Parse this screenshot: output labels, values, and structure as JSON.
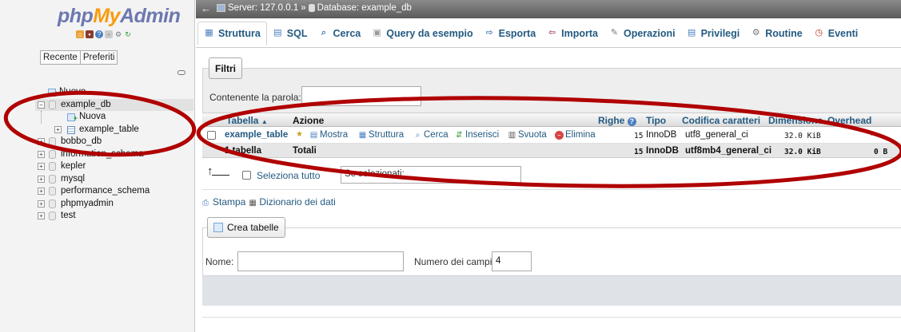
{
  "nav": {
    "logo": {
      "php": "php",
      "my": "My",
      "admin": "Admin"
    },
    "icons": [
      "home-icon",
      "db-icon",
      "help-icon",
      "docs-icon",
      "settings-icon",
      "reload-icon"
    ],
    "tabs": [
      "Recente",
      "Preferiti"
    ],
    "tree": [
      {
        "label": "Nuovo",
        "kind": "new"
      },
      {
        "label": "example_db",
        "kind": "db",
        "selected": true
      },
      {
        "label": "Nuova",
        "kind": "new-table"
      },
      {
        "label": "example_table",
        "kind": "table"
      },
      {
        "label": "bobbo_db",
        "kind": "db"
      },
      {
        "label": "information_schema",
        "kind": "db"
      },
      {
        "label": "kepler",
        "kind": "db"
      },
      {
        "label": "mysql",
        "kind": "db"
      },
      {
        "label": "performance_schema",
        "kind": "db"
      },
      {
        "label": "phpmyadmin",
        "kind": "db"
      },
      {
        "label": "test",
        "kind": "db"
      }
    ]
  },
  "topbar": {
    "server_label": "Server: 127.0.0.1",
    "separator": "»",
    "database_label": "Database: example_db"
  },
  "tabs": [
    {
      "label": "Struttura",
      "icon": "structure-icon",
      "active": true
    },
    {
      "label": "SQL",
      "icon": "sql-icon"
    },
    {
      "label": "Cerca",
      "icon": "search-icon"
    },
    {
      "label": "Query da esempio",
      "icon": "query-icon"
    },
    {
      "label": "Esporta",
      "icon": "export-icon"
    },
    {
      "label": "Importa",
      "icon": "import-icon"
    },
    {
      "label": "Operazioni",
      "icon": "wrench-icon"
    },
    {
      "label": "Privilegi",
      "icon": "privileges-icon"
    },
    {
      "label": "Routine",
      "icon": "routine-icon"
    },
    {
      "label": "Eventi",
      "icon": "clock-icon"
    }
  ],
  "filter": {
    "legend": "Filtri",
    "label": "Contenente la parola:",
    "value": ""
  },
  "table": {
    "headers": {
      "table": "Tabella",
      "sort_arrow": "▲",
      "action": "Azione",
      "rows": "Righe",
      "type": "Tipo",
      "collation": "Codifica caratteri",
      "size": "Dimensione",
      "overhead": "Overhead"
    },
    "row": {
      "name": "example_table",
      "actions": [
        "Mostra",
        "Struttura",
        "Cerca",
        "Inserisci",
        "Svuota",
        "Elimina"
      ],
      "rows": "15",
      "type": "InnoDB",
      "collation": "utf8_general_ci",
      "size": "32.0 KiB",
      "overhead": "-"
    },
    "totals": {
      "name": "1 tabella",
      "label": "Totali",
      "rows": "15",
      "type": "InnoDB",
      "collation": "utf8mb4_general_ci",
      "size": "32.0 KiB",
      "overhead": "0 B"
    }
  },
  "with_selected": {
    "check_all": "Seleziona tutto",
    "select_value": "Se selezionati:"
  },
  "utils": {
    "print": "Stampa",
    "dictionary": "Dizionario dei dati"
  },
  "create": {
    "legend": "Crea tabelle",
    "name_label": "Nome:",
    "name_value": "",
    "ncols_label": "Numero dei campi:",
    "ncols_value": "4"
  },
  "colors": {
    "link": "#235a81",
    "annotation": "#b00000",
    "logo_blue": "#6c78af",
    "logo_orange": "#f89c0e"
  }
}
